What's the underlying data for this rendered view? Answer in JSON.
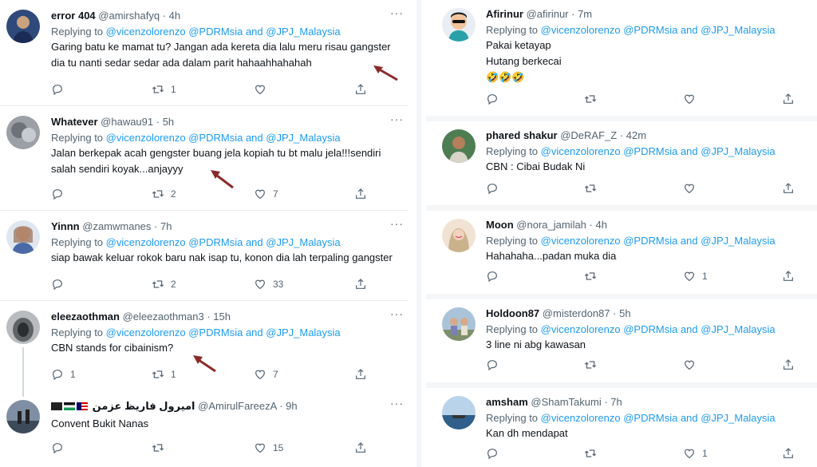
{
  "reply_label": "Replying to",
  "reply_mentions": [
    "@vicenzolorenzo",
    "@PDRMsia",
    "@JPJ_Malaysia"
  ],
  "reply_and": "and",
  "more_label": "···",
  "left_tweets": [
    {
      "name": "error 404",
      "handle": "@amirshafyq",
      "time": "· 4h",
      "text": "Garing batu ke mamat tu? Jangan ada kereta dia lalu meru risau gangster\ndia tu nanti sedar sedar ada dalam parit hahaahhahahah",
      "replies": "",
      "retweets": "1",
      "likes": ""
    },
    {
      "name": "Whatever",
      "handle": "@hawau91",
      "time": "· 5h",
      "text": "Jalan berkepak acah gengster buang jela kopiah tu bt malu jela!!!sendiri\nsalah sendiri koyak...anjayyy",
      "replies": "",
      "retweets": "2",
      "likes": "7"
    },
    {
      "name": "Yinnn",
      "handle": "@zamwmanes",
      "time": "· 7h",
      "text": "siap bawak keluar rokok baru nak isap tu, konon dia lah terpaling gangster",
      "replies": "",
      "retweets": "2",
      "likes": "33"
    },
    {
      "name": "eleezaothman",
      "handle": "@eleezaothman3",
      "time": "· 15h",
      "text": "CBN stands for cibainism?",
      "replies": "1",
      "retweets": "1",
      "likes": "7"
    },
    {
      "name": "اميرول فاريظ عزمن",
      "handle": "@AmirulFareezA",
      "time": "· 9h",
      "text": "Convent Bukit Nanas",
      "replies": "",
      "retweets": "",
      "likes": "15"
    }
  ],
  "right_tweets": [
    {
      "name": "Afirinur",
      "handle": "@afirinur",
      "time": "· 7m",
      "text": "Pakai ketayap\nHutang berkecai\n🤣🤣🤣",
      "replies": "",
      "retweets": "",
      "likes": ""
    },
    {
      "name": "phared shakur",
      "handle": "@DeRAF_Z",
      "time": "· 42m",
      "text": "CBN : Cibai Budak Ni",
      "replies": "",
      "retweets": "",
      "likes": ""
    },
    {
      "name": "Moon",
      "handle": "@nora_jamilah",
      "time": "· 4h",
      "text": "Hahahaha...padan muka dia",
      "replies": "",
      "retweets": "",
      "likes": "1"
    },
    {
      "name": "Holdoon87",
      "handle": "@misterdon87",
      "time": "· 5h",
      "text": "3 line ni abg kawasan",
      "replies": "",
      "retweets": "",
      "likes": ""
    },
    {
      "name": "amsham",
      "handle": "@ShamTakumi",
      "time": "· 7h",
      "text": "Kan dh mendapat",
      "replies": "",
      "retweets": "",
      "likes": "1"
    }
  ],
  "icons": [
    "reply-icon",
    "retweet-icon",
    "like-icon",
    "share-icon",
    "more-icon"
  ],
  "colors": {
    "mention": "#1d9bf0",
    "muted": "#536471",
    "annotation_arrow": "#8b2a2a"
  }
}
